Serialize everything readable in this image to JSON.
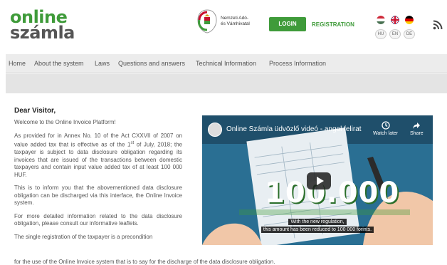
{
  "header": {
    "logo_line1": "online",
    "logo_line2": "számla",
    "nav_agency_line1": "Nemzeti Adó-",
    "nav_agency_line2": "és Vámhivatal",
    "login_label": "LOGIN",
    "registration_label": "REGISTRATION",
    "languages": [
      {
        "code": "HU"
      },
      {
        "code": "EN"
      },
      {
        "code": "DE"
      }
    ]
  },
  "navbar": {
    "items": [
      {
        "label": "Home"
      },
      {
        "label": "About the system"
      },
      {
        "label": "Laws"
      },
      {
        "label": "Questions and answers"
      },
      {
        "label": "Technical Information"
      },
      {
        "label": "Process Information"
      }
    ]
  },
  "content": {
    "greeting": "Dear Visitor,",
    "welcome": "Welcome to the Online Invoice Platform!",
    "para1_a": "As provided for in Annex No. 10 of the Act CXXVII of 2007 on value added tax that is effective as of the 1",
    "para1_sup": "st",
    "para1_b": " of July, 2018; the taxpayer is subject to data disclosure obligation regarding its invoices that are issued of the transactions between domestic taxpayers and contain input value added tax of at least 100 000 HUF.",
    "para2": "This is to inform you that the abovementioned data disclosure obligation can be discharged via this interface, the Online Invoice system.",
    "para3": "For more detailed information related to the data disclosure obligation, please consult our informative leaflets.",
    "para4": "The single registration of the taxpayer is a precondition",
    "para4_cont": "for the use of the Online Invoice system that is to say for the discharge of the data disclosure obligation."
  },
  "video": {
    "title": "Online Számla üdvözlő videó - angol felirat",
    "watch_later": "Watch later",
    "share": "Share",
    "big_number": "100.000",
    "caption_line1": "With the new regulation,",
    "caption_line2": "this amount has been reduced to 100 000 forints."
  },
  "colors": {
    "brand_green": "#3f9b3a",
    "navbar_bg": "#ececec",
    "video_bg": "#1e5a7c"
  }
}
